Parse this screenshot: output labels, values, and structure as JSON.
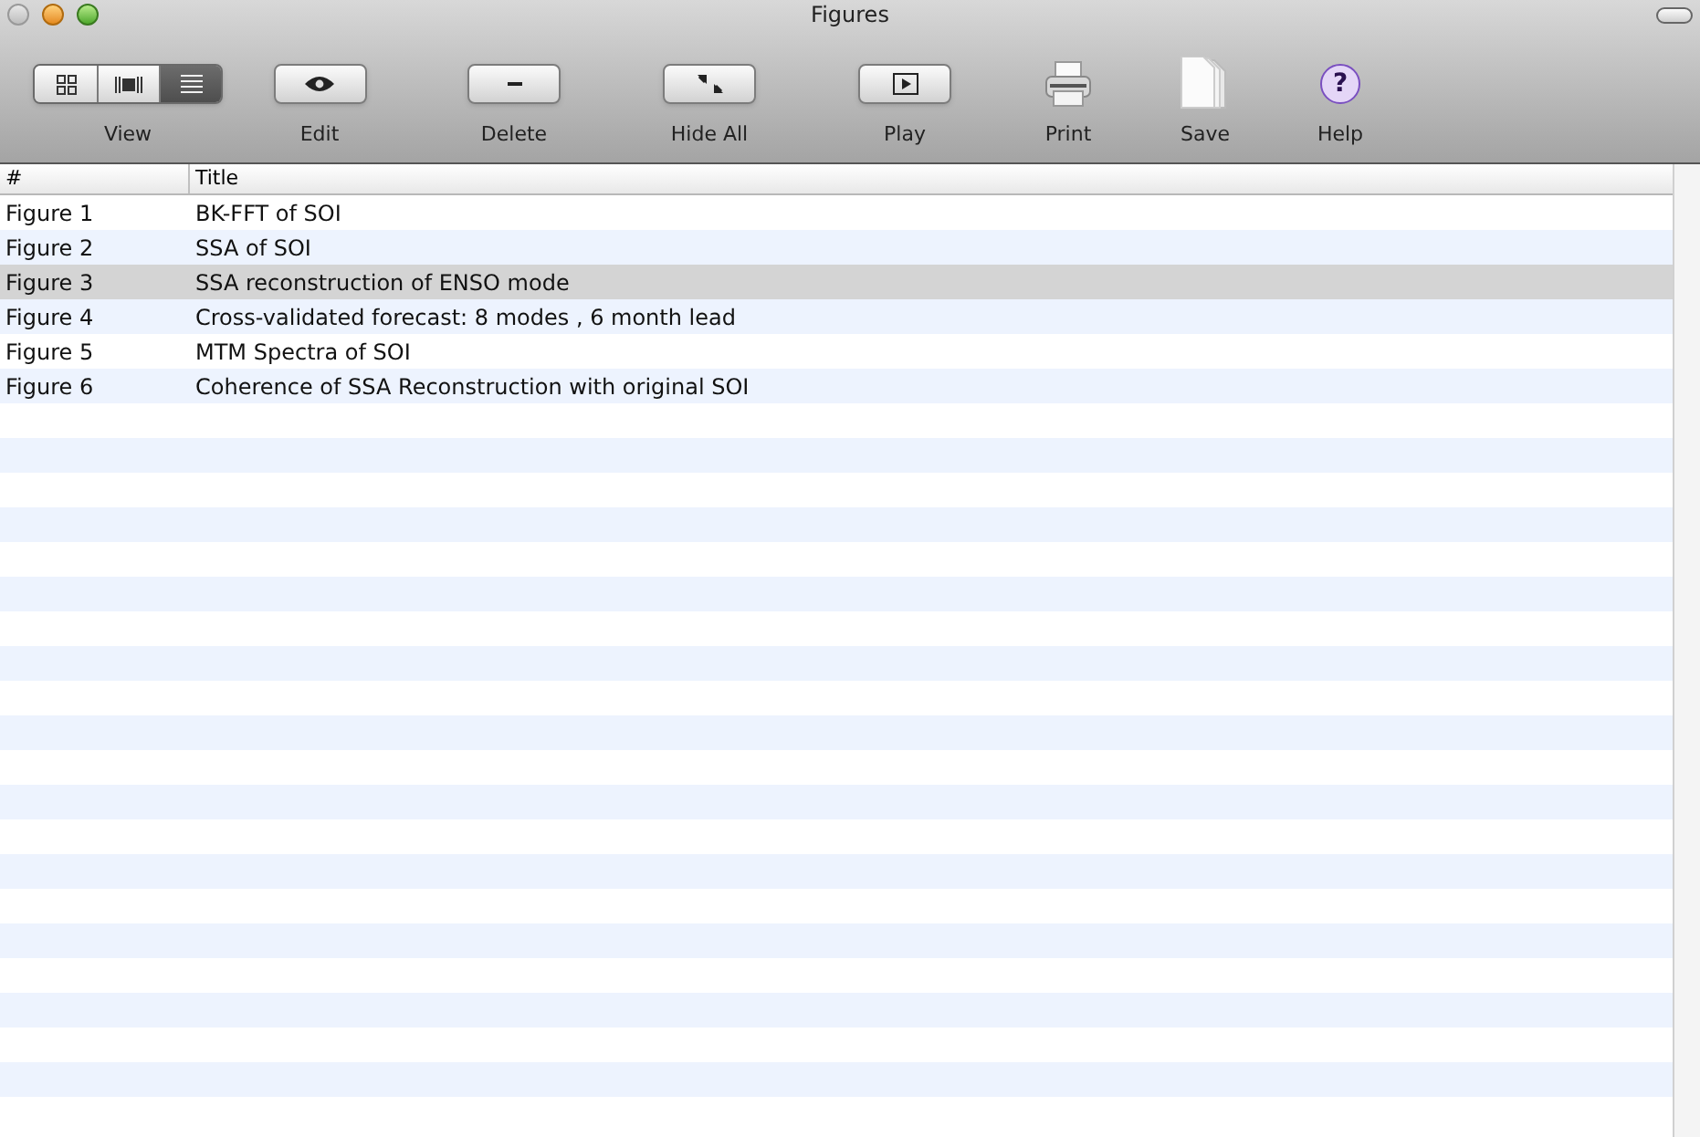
{
  "window": {
    "title": "Figures"
  },
  "toolbar": [
    {
      "kind": "segmented",
      "label": "View",
      "segments": [
        {
          "selected": false
        },
        {
          "selected": false
        },
        {
          "selected": true
        }
      ]
    },
    {
      "kind": "button",
      "label": "Edit"
    },
    {
      "kind": "button",
      "label": "Delete"
    },
    {
      "kind": "button",
      "label": "Hide All"
    },
    {
      "kind": "button",
      "label": "Play"
    },
    {
      "kind": "plain",
      "label": "Print"
    },
    {
      "kind": "plain",
      "label": "Save"
    },
    {
      "kind": "badge",
      "glyph": "?",
      "label": "Help"
    }
  ],
  "table": {
    "columns": [
      "#",
      "Title"
    ],
    "rows": [
      {
        "number": "Figure 1",
        "title": "BK-FFT of SOI",
        "selected": false
      },
      {
        "number": "Figure 2",
        "title": "SSA of SOI",
        "selected": false
      },
      {
        "number": "Figure 3",
        "title": "SSA reconstruction of ENSO mode",
        "selected": true
      },
      {
        "number": "Figure 4",
        "title": "Cross-validated forecast: 8 modes , 6 month lead",
        "selected": false
      },
      {
        "number": "Figure 5",
        "title": "MTM Spectra of SOI",
        "selected": false
      },
      {
        "number": "Figure 6",
        "title": "Coherence of SSA Reconstruction with original SOI",
        "selected": false
      }
    ]
  }
}
